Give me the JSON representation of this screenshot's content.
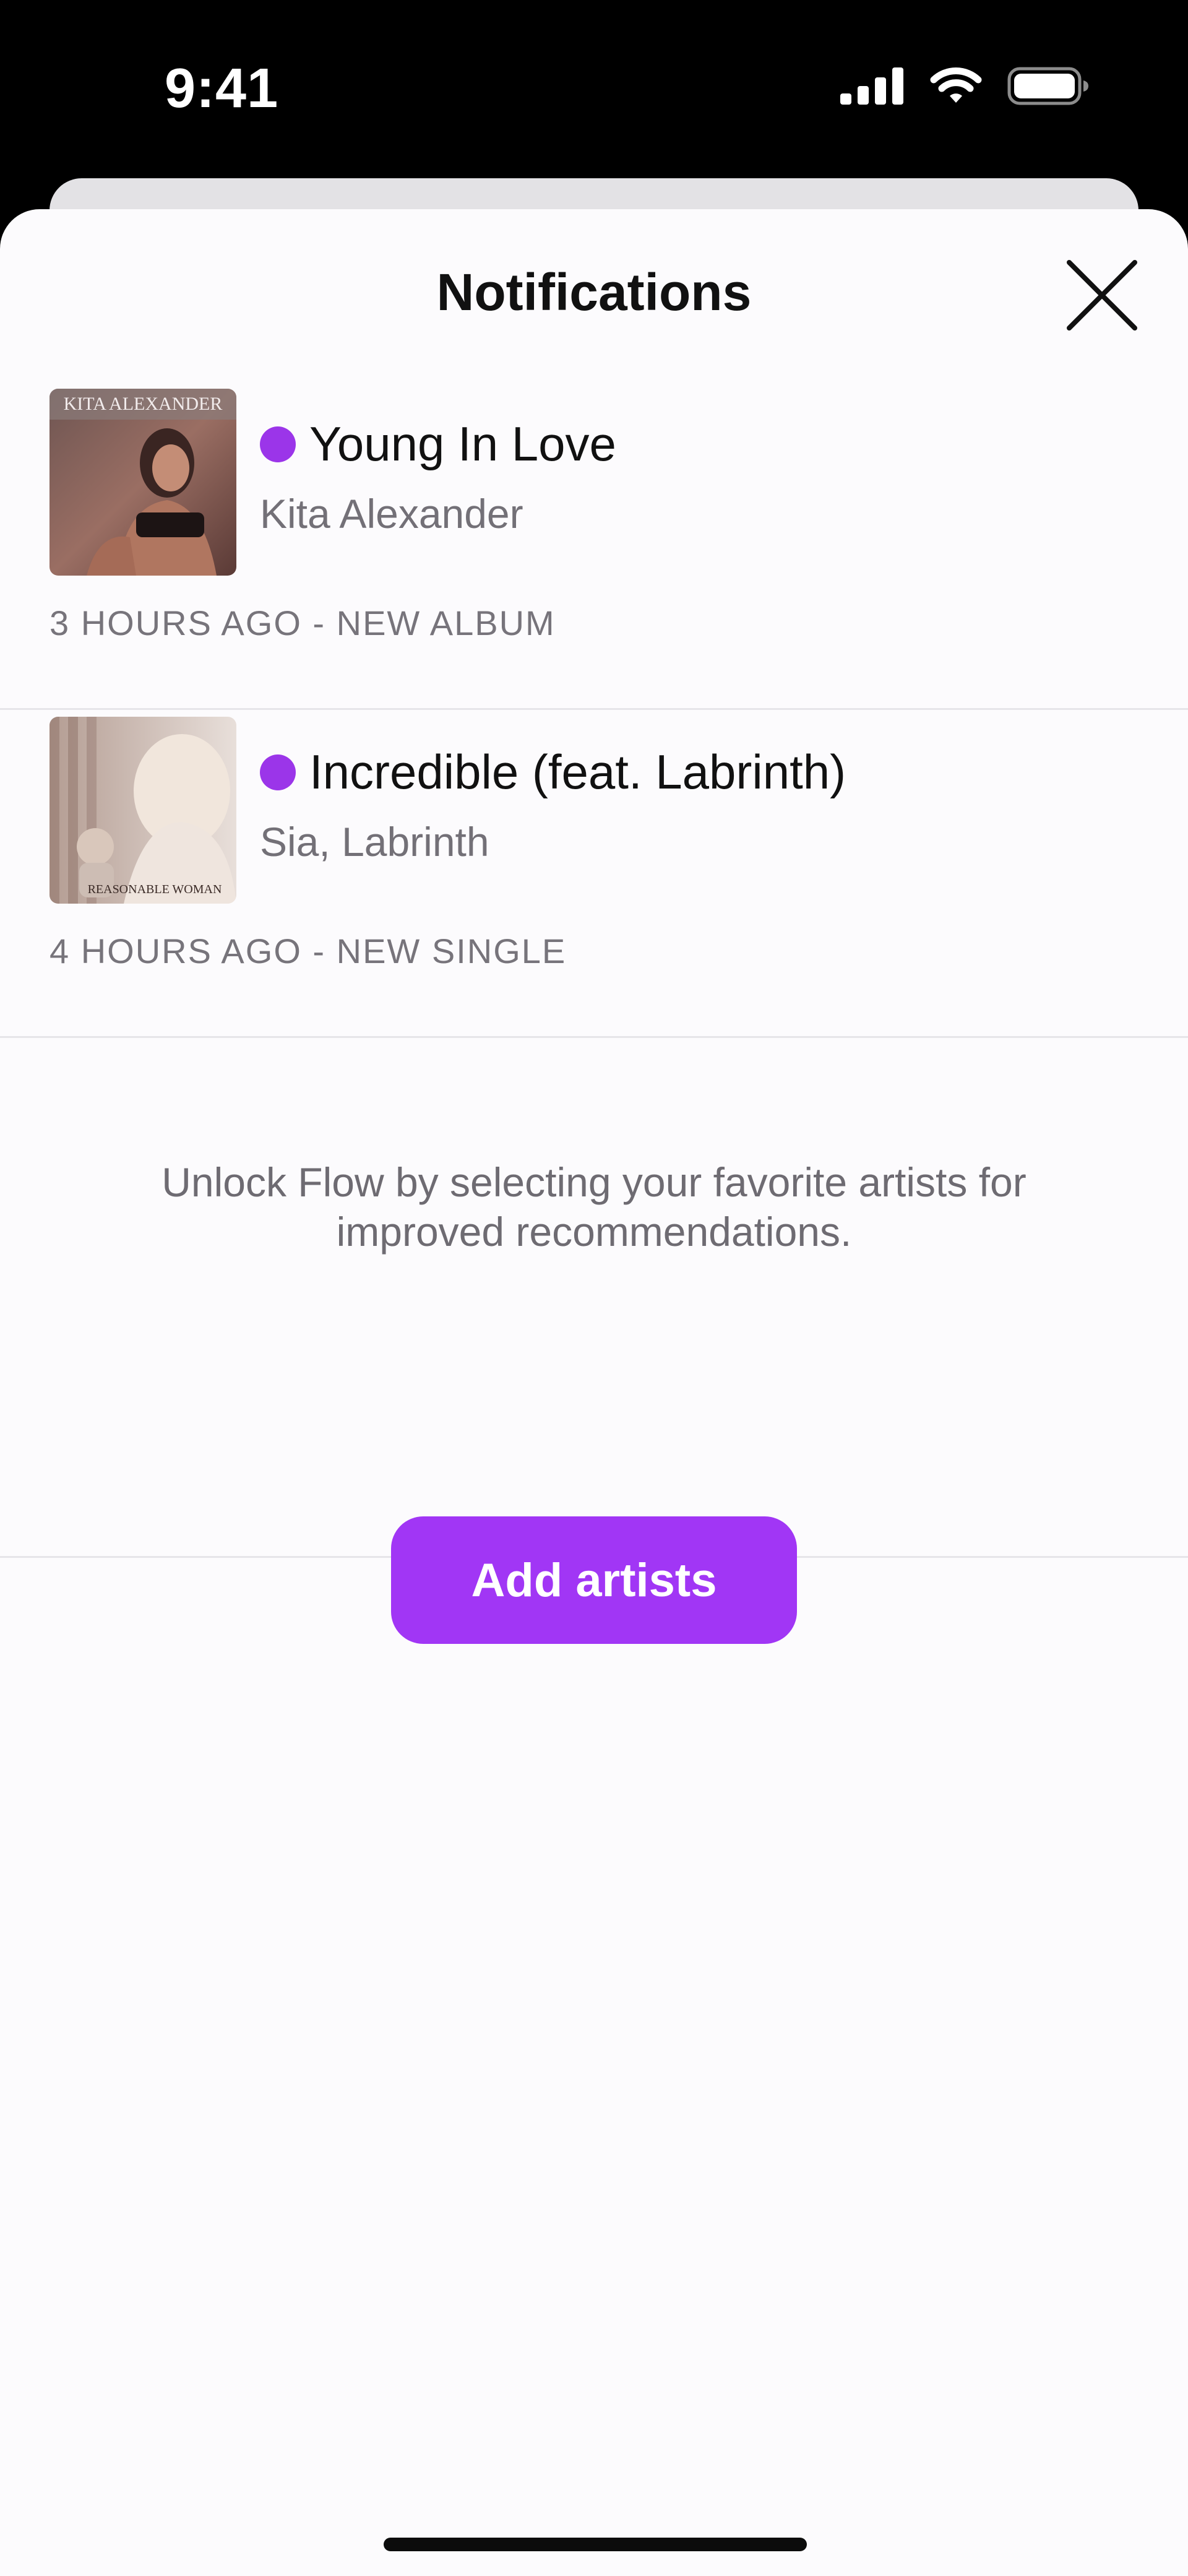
{
  "status_bar": {
    "time": "9:41",
    "icons": [
      "cellular-signal-icon",
      "wifi-icon",
      "battery-icon"
    ]
  },
  "sheet": {
    "title": "Notifications",
    "close_icon": "close-icon"
  },
  "notifications": [
    {
      "title": "Young In Love",
      "subtitle": "Kita Alexander",
      "meta": "3 HOURS AGO - NEW ALBUM",
      "art_text": "KITA ALEXANDER",
      "unread": true
    },
    {
      "title": "Incredible (feat. Labrinth)",
      "subtitle": "Sia, Labrinth",
      "meta": "4 HOURS AGO - NEW SINGLE",
      "art_text": "REASONABLE WOMAN",
      "unread": true
    }
  ],
  "promo": {
    "text": "Unlock Flow by selecting your favorite artists for improved recommendations.",
    "button_label": "Add artists"
  },
  "colors": {
    "accent": "#a136f5",
    "unread_dot": "#9b35e9",
    "sheet_background": "#fcfbfd",
    "divider": "#e6e5e9"
  }
}
